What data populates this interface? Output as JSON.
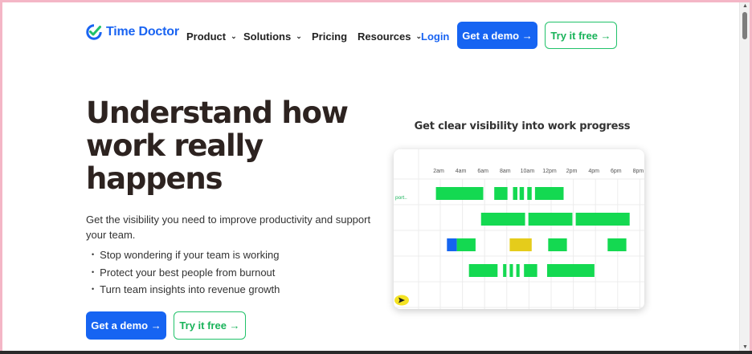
{
  "nav": {
    "logo_text": "Time Doctor",
    "items": [
      {
        "label": "Product",
        "chevron": true
      },
      {
        "label": "Solutions",
        "chevron": true
      },
      {
        "label": "Pricing",
        "chevron": false
      },
      {
        "label": "Resources",
        "chevron": true
      }
    ],
    "login": "Login",
    "demo_button": "Get a demo →",
    "try_button": "Try it free →"
  },
  "hero": {
    "title_lines": [
      "Understand how",
      "work really",
      "happens"
    ],
    "subtitle": "Get the visibility you need to improve productivity and support your team.",
    "bullets": [
      "Stop wondering if your team is working",
      "Protect your best people from burnout",
      "Turn team insights into revenue growth"
    ],
    "demo_button": "Get a demo →",
    "try_button": "Try it free →"
  },
  "visibility": {
    "title": "Get clear visibility into work progress",
    "row_label": "port..",
    "hours": [
      "2am",
      "4am",
      "6am",
      "8am",
      "10am",
      "12pm",
      "2pm",
      "4pm",
      "6pm",
      "8pm"
    ],
    "colors": {
      "green": "#14d951",
      "blue": "#1565f0",
      "yellow": "#e5cc1b",
      "grid": "#ececec",
      "badge": "#f4e324"
    },
    "rows": [
      [
        {
          "start": 0.7,
          "end": 5.0,
          "color": "green"
        },
        {
          "start": 6.0,
          "end": 7.2,
          "color": "green"
        },
        {
          "start": 7.7,
          "end": 8.1,
          "color": "green"
        },
        {
          "start": 8.3,
          "end": 8.7,
          "color": "green"
        },
        {
          "start": 9.0,
          "end": 9.4,
          "color": "green"
        },
        {
          "start": 9.7,
          "end": 12.3,
          "color": "green"
        }
      ],
      [
        {
          "start": 4.8,
          "end": 8.8,
          "color": "green"
        },
        {
          "start": 9.1,
          "end": 13.1,
          "color": "green"
        },
        {
          "start": 13.4,
          "end": 18.3,
          "color": "green"
        }
      ],
      [
        {
          "start": 1.7,
          "end": 2.6,
          "color": "blue"
        },
        {
          "start": 2.6,
          "end": 4.3,
          "color": "green"
        },
        {
          "start": 7.4,
          "end": 9.4,
          "color": "yellow"
        },
        {
          "start": 10.9,
          "end": 12.6,
          "color": "green"
        },
        {
          "start": 16.3,
          "end": 18.0,
          "color": "green"
        }
      ],
      [
        {
          "start": 3.7,
          "end": 6.3,
          "color": "green"
        },
        {
          "start": 6.8,
          "end": 7.1,
          "color": "green"
        },
        {
          "start": 7.4,
          "end": 7.7,
          "color": "green"
        },
        {
          "start": 8.0,
          "end": 8.3,
          "color": "green"
        },
        {
          "start": 8.7,
          "end": 9.9,
          "color": "green"
        },
        {
          "start": 10.8,
          "end": 15.1,
          "color": "green"
        }
      ]
    ]
  }
}
